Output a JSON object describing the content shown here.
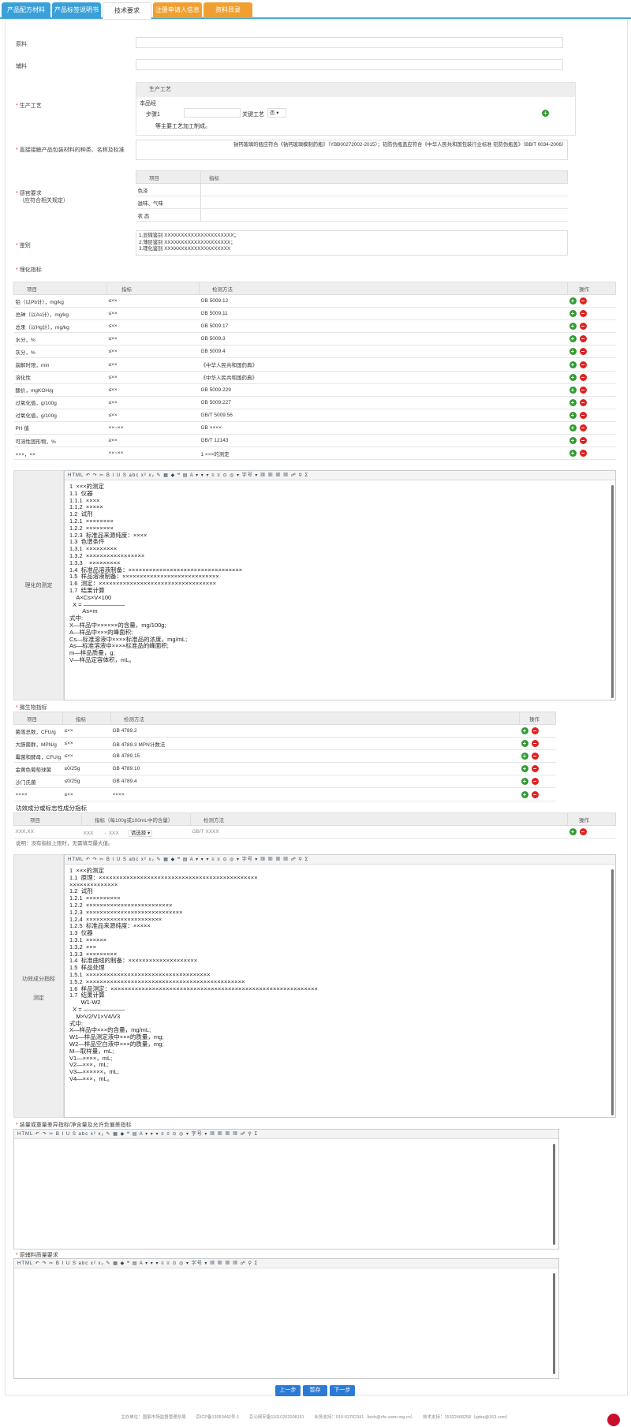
{
  "tabs": [
    {
      "label": "产品配方材料"
    },
    {
      "label": "产品标签说明书"
    },
    {
      "label": "技术要求"
    },
    {
      "label": "注册申请人信息"
    },
    {
      "label": "资料目录"
    }
  ],
  "form": {
    "raw_material_label": "原料",
    "auxiliary_label": "辅料",
    "process_label": "生产工艺",
    "process_header": "生产工艺",
    "process_text": "本品经",
    "step_label": "步骤1",
    "key_process_label": "关键工艺",
    "key_process_value": "否",
    "process_note": "等主要工艺加工制成。",
    "packaging_label": "直接接触产品包装材料的种类、名称及标准",
    "packaging_text": "钠钙玻璃的瓶应符合《钠钙玻璃模制药瓶》（YBB00272002-2015）；铝防伪瓶盖应符合《中华人民共和国包装行业标准 铝防伪瓶盖》（BB/T 0034-2006）",
    "sensory_label": "感官要求",
    "sensory_sublabel": "（应符合相关规定）",
    "sensory_header": [
      "项目",
      "指标"
    ],
    "sensory_rows": [
      "色泽",
      "滋味、气味",
      "状 态"
    ],
    "identify_label": "鉴别",
    "identify_lines": [
      "1.显微鉴别 XXXXXXXXXXXXXXXXXXXXX；",
      "2.薄层鉴别 XXXXXXXXXXXXXXXXXXXX；",
      "3.理化鉴别 XXXXXXXXXXXXXXXXXXXX"
    ],
    "phys_label": "理化指标"
  },
  "phys_table": {
    "headers": [
      "项目",
      "指标",
      "检测方法",
      "操作"
    ],
    "rows": [
      [
        "铅（以Pb计），mg/kg",
        "≤××",
        "GB 5009.12"
      ],
      [
        "总砷（以As计），mg/kg",
        "≤××",
        "GB 5009.11"
      ],
      [
        "总汞（以Hg计），mg/kg",
        "≤××",
        "GB 5009.17"
      ],
      [
        "水分，%",
        "≤××",
        "GB 5009.3"
      ],
      [
        "灰分，%",
        "≤××",
        "GB 5009.4"
      ],
      [
        "崩解时限，min",
        "≤××",
        "《中华人民共和国药典》"
      ],
      [
        "溶化性",
        "≤××",
        "《中华人民共和国药典》"
      ],
      [
        "酸价，mgKOH/g",
        "≤××",
        "GB 5009.229"
      ],
      [
        "过氧化值，g/100g",
        "≤××",
        "GB 5009.227"
      ],
      [
        "过氧化值，g/100g",
        "≤××",
        "GB/T 5009.56"
      ],
      [
        "PH 值",
        "××~××",
        "GB ××××"
      ],
      [
        "可溶性固形物，%",
        "≥××",
        "GB/T 12143"
      ],
      [
        "×××，××",
        "××~××",
        "1 ×××的测定"
      ]
    ]
  },
  "editor1": {
    "side_label": "理化的测定",
    "toolbar": "HTML ↶ ↷ ✂ B I U S abc x² x₂ ✎ ▦ ◆ ❝ ▤ A ▾ ▾ ▾ ≡ ≡ ⊙ ◎ ▾  字号 ▾  ▦ ▦ ▦ ▦ ☍ ⚲ Σ",
    "content": "1  ×××的测定\n1.1  仪器\n1.1.1  ××××\n1.1.2  ×××××\n1.2  试剂\n1.2.1  ××××××××\n1.2.2  ××××××××\n1.2.3  标准品来源纯度：××××\n1.3  色谱条件\n1.3.1  ×××××××××\n1.3.2  ×××××××××××××××××\n1.3.3    ×××××××××\n1.4  标准品溶液制备：×××××××××××××××××××××××××××××××××\n1.5  样品溶液制备：××××××××××××××××××××××××××××\n1.6  测定：××××××××××××××××××××××××××××××××××\n1.7  结果计算\n    A×Cs×V×100\n  X = ———————\n        As×m\n式中:\nX—样品中××××××的含量，mg/100g;\nA—样品中×××的峰面积;\nCs—标准溶液中××××标准品的浓度，mg/mL;\nAs—标准溶液中××××标准品的峰面积;\nm—样品质量，g;\nV—样品定容体积，mL。"
  },
  "micro": {
    "label": "微生物指标",
    "headers": [
      "项目",
      "指标",
      "检测方法",
      "操作"
    ],
    "rows": [
      [
        "菌落总数，CFU/g",
        "≤××",
        "GB 4789.2"
      ],
      [
        "大肠菌群，MPN/g",
        "≤××",
        "GB 4789.3 MPN计数法"
      ],
      [
        "霉菌和酵母，CFU/g",
        "≤××",
        "GB 4789.15"
      ],
      [
        "金黄色葡萄球菌",
        "≤0/25g",
        "GB 4789.10"
      ],
      [
        "沙门氏菌",
        "≤0/25g",
        "GB 4789.4"
      ],
      [
        "××××",
        "≤××",
        "××××"
      ]
    ]
  },
  "func": {
    "label": "功效成分或标志性成分指标",
    "headers": [
      "项目",
      "指标（每100g或100mL中的含量）",
      "检测方法",
      "操作"
    ],
    "row": {
      "item": "XXX,XX",
      "min": "XXX",
      "max": "XXX",
      "select": "请选择",
      "method": "GB/T XXXX"
    },
    "note": "说明：没有指标上限时，无需填写最大值。"
  },
  "editor2": {
    "side_label_1": "功效成分指标",
    "side_label_2": "测定",
    "toolbar": "HTML ↶ ↷ ✂ B I U S abc x² x₂ ✎ ▦ ◆ ❝ ▤ A ▾ ▾ ▾ ≡ ≡ ⊙ ◎ ▾  字号 ▾  ▦ ▦ ▦ ▦ ☍ ⚲ Σ",
    "content": "1  ×××的测定\n1.1  原理：××××××××××××××××××××××××××××××××××××××××××××××\n××××××××××××××\n1.2  试剂\n1.2.1  ××××××××××\n1.2.2  ×××××××××××××××××××××××××\n1.2.3  ××××××××××××××××××××××××××××\n1.2.4  ××××××××××××××××××××××\n1.2.5  标准品来源纯度：×××××\n1.3  仪器\n1.3.1  ××××××\n1.3.2  ×××\n1.3.3  ×××××××××\n1.4  标准曲线的制备：××××××××××××××××××××\n1.5  样品处理\n1.5.1  ××××××××××××××××××××××××××××××××××××\n1.5.2  ××××××××××××××××××××××××××××××××××××××××××××××\n1.6  样品测定：××××××××××××××××××××××××××××××××××××××××××××××××××××××××××××\n1.7  结果计算\n       W1-W2\n  X = ———————\n    M×V2/V1×V4/V3\n式中:\nX—样品中×××的含量，mg/mL;\nW1—样品测定液中×××的质量，mg;\nW2—样品空白液中×××的质量，mg;\nM—取样量，mL;\nV1—××××，mL;\nV2—×××，mL;\nV3—××××××，mL;\nV4—×××，mL。"
  },
  "editor3": {
    "label": "装量或重量差异指标/净含量及允许负偏差指标",
    "toolbar": "HTML ↶ ↷ ✂ B I U S abc x² x₂ ✎ ▦ ◆ ❝ ▤ A ▾ ▾ ▾ ≡ ≡ ⊙ ◎ ▾  字号 ▾  ▦ ▦ ▦ ▦ ☍ ⚲ Σ"
  },
  "editor4": {
    "label": "原辅料质量要求",
    "toolbar": "HTML ↶ ↷ ✂ B I U S abc x² x₂ ✎ ▦ ◆ ❝ ▤ A ▾ ▾ ▾ ≡ ≡ ⊙ ◎ ▾  字号 ▾  ▦ ▦ ▦ ▦ ☍ ⚲ Σ"
  },
  "buttons": {
    "prev": "上一步",
    "save": "暂存",
    "next": "下一步"
  },
  "footer": {
    "host": "主办单位：国家市场监督管理总局",
    "icp": "京ICP备13053442号-1",
    "psb": "京公网安备11010202008151",
    "support": "业务支持：010-53702341（tech@cfe-samr.org.cn）",
    "tech": "技术支持：15322468258（ypba@163.com）"
  }
}
